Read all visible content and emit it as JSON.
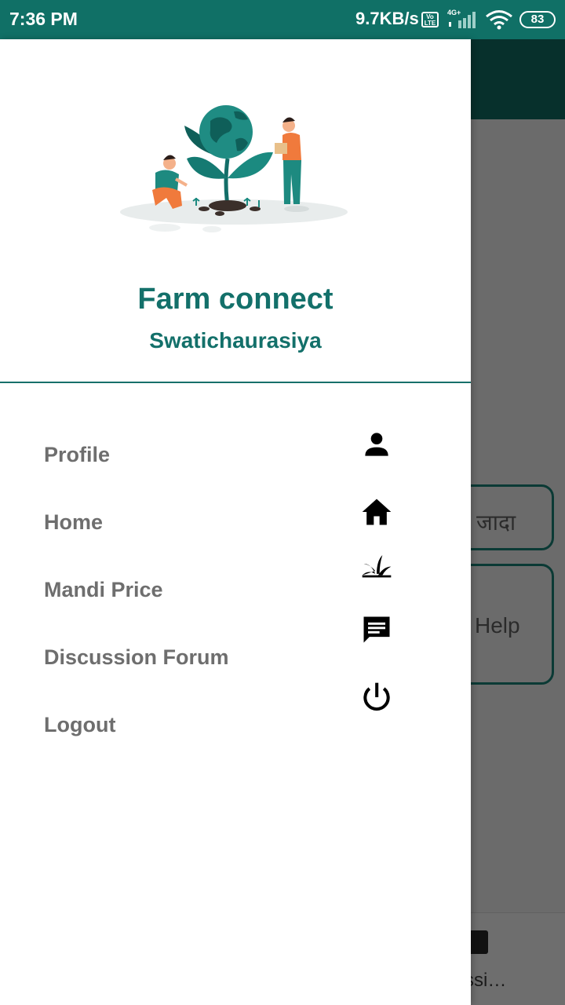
{
  "status_bar": {
    "time": "7:36 PM",
    "network_speed": "9.7KB/s",
    "volte": "Vo LTE",
    "signal_label": "4G+",
    "battery": "83"
  },
  "background_app": {
    "card1_text": "जादा",
    "card2_text": "Help",
    "bottom_tab_label": "ssi…"
  },
  "drawer": {
    "header": {
      "app_title": "Farm connect",
      "user_name": "Swatichaurasiya"
    },
    "menu_items": [
      {
        "label": "Profile",
        "icon": "person-icon"
      },
      {
        "label": "Home",
        "icon": "home-icon"
      },
      {
        "label": "Mandi Price",
        "icon": "grass-icon"
      },
      {
        "label": "Discussion Forum",
        "icon": "chat-icon"
      },
      {
        "label": "Logout",
        "icon": "power-icon"
      }
    ]
  },
  "colors": {
    "primary": "#107066",
    "primary_dark": "#07302c",
    "menu_text": "#6e6e6e",
    "scrim": "#6b6b6b"
  }
}
